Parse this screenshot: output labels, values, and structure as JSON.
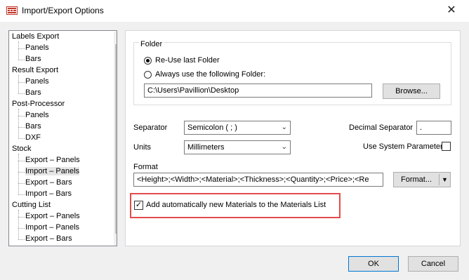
{
  "window": {
    "title": "Import/Export Options",
    "close_glyph": "✕"
  },
  "tree": {
    "items": [
      {
        "label": "Labels Export",
        "level": 0
      },
      {
        "label": "Panels",
        "level": 1
      },
      {
        "label": "Bars",
        "level": 1
      },
      {
        "label": "Result Export",
        "level": 0
      },
      {
        "label": "Panels",
        "level": 1
      },
      {
        "label": "Bars",
        "level": 1
      },
      {
        "label": "Post-Processor",
        "level": 0
      },
      {
        "label": "Panels",
        "level": 1
      },
      {
        "label": "Bars",
        "level": 1
      },
      {
        "label": "DXF",
        "level": 1
      },
      {
        "label": "Stock",
        "level": 0
      },
      {
        "label": "Export – Panels",
        "level": 1
      },
      {
        "label": "Import – Panels",
        "level": 1,
        "selected": true
      },
      {
        "label": "Export – Bars",
        "level": 1
      },
      {
        "label": "Import – Bars",
        "level": 1
      },
      {
        "label": "Cutting List",
        "level": 0
      },
      {
        "label": "Export – Panels",
        "level": 1
      },
      {
        "label": "Import – Panels",
        "level": 1
      },
      {
        "label": "Export – Bars",
        "level": 1
      }
    ],
    "scroll_up_glyph": "▲",
    "scroll_down_glyph": "▼"
  },
  "folder": {
    "group_label": "Folder",
    "reuse_label": "Re-Use last Folder",
    "always_label": "Always use the following Folder:",
    "path_value": "C:\\Users\\Pavillion\\Desktop",
    "browse_label": "Browse..."
  },
  "settings": {
    "separator_label": "Separator",
    "separator_value": "Semicolon  ( ; )",
    "units_label": "Units",
    "units_value": "Millimeters",
    "decimal_label": "Decimal Separator",
    "decimal_value": ".",
    "system_param_label": "Use System Parameter",
    "format_label": "Format",
    "format_value": "<Height>;<Width>;<Material>;<Thickness>;<Quantity>;<Price>;<Re",
    "format_button": "Format...",
    "add_materials_label": "Add automatically new Materials to the Materials List",
    "add_materials_checked": true
  },
  "buttons": {
    "ok": "OK",
    "cancel": "Cancel"
  },
  "colors": {
    "highlight": "#e34b4b",
    "accent": "#0078d7"
  }
}
